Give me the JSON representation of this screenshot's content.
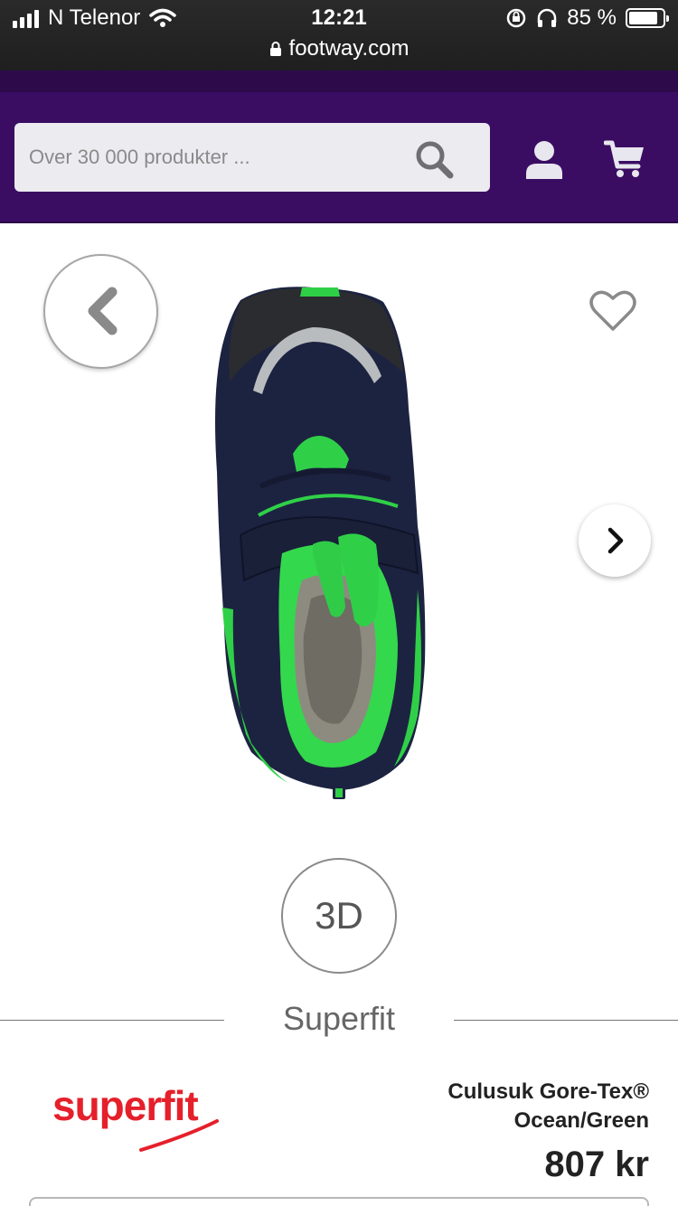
{
  "status_bar": {
    "carrier": "N Telenor",
    "time": "12:21",
    "battery_text": "85 %",
    "battery_level": 0.85,
    "url": "footway.com",
    "icons": [
      "signal-icon",
      "wifi-icon",
      "rotation-lock-icon",
      "headphones-icon",
      "battery-icon",
      "lock-icon"
    ]
  },
  "header": {
    "search_placeholder": "Over 30 000 produkter ...",
    "icons": [
      "search-icon",
      "user-icon",
      "cart-icon"
    ],
    "background": "#3a0d63"
  },
  "product": {
    "nav_icons": [
      "chevron-left-icon",
      "chevron-right-icon",
      "heart-icon"
    ],
    "view_3d_label": "3D",
    "brand_label": "Superfit",
    "logo_text": "superfit",
    "name_line1": "Culusuk Gore-Tex®",
    "name_line2": "Ocean/Green",
    "price": "807 kr"
  },
  "colors": {
    "brand_purple": "#3a0d63",
    "logo_red": "#e5202b",
    "shoe_navy": "#1c2340",
    "shoe_green": "#2fd048"
  }
}
